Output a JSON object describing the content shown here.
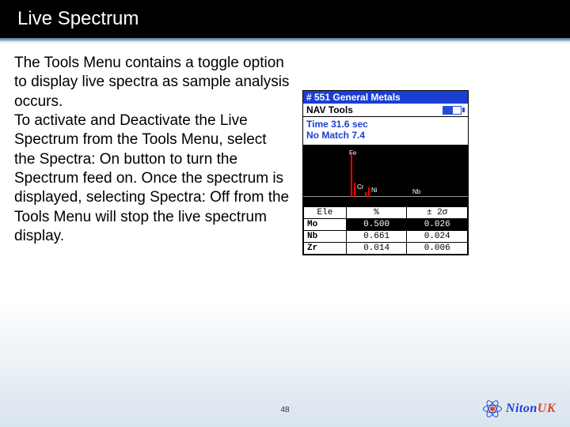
{
  "title": "Live Spectrum",
  "body_lead": "The Tools Menu contains a toggle option to display live spectra as sample analysis occurs.",
  "body_rest": "To activate and Deactivate the Live Spectrum from the Tools Menu, select the Spectra: On button to turn the Spectrum feed on. Once the spectrum is displayed, selecting Spectra: Off from the Tools Menu will stop the live spectrum display.",
  "device": {
    "header": "# 551 General Metals",
    "subheader": "NAV Tools",
    "time_line": "Time 31.6 sec",
    "match_line": "No Match 7.4",
    "peaks": [
      "Fe",
      "Cr",
      "Ni",
      "Nb"
    ],
    "table": {
      "headers": [
        "Ele",
        "%",
        "± 2σ"
      ],
      "rows": [
        {
          "ele": "Mo",
          "pct": "0.500",
          "sigma": "0.026",
          "highlight": true
        },
        {
          "ele": "Nb",
          "pct": "0.661",
          "sigma": "0.024",
          "highlight": false
        },
        {
          "ele": "Zr",
          "pct": "0.014",
          "sigma": "0.006",
          "highlight": false
        }
      ]
    }
  },
  "page_number": "48",
  "brand": {
    "name": "Niton",
    "suffix": "UK"
  }
}
